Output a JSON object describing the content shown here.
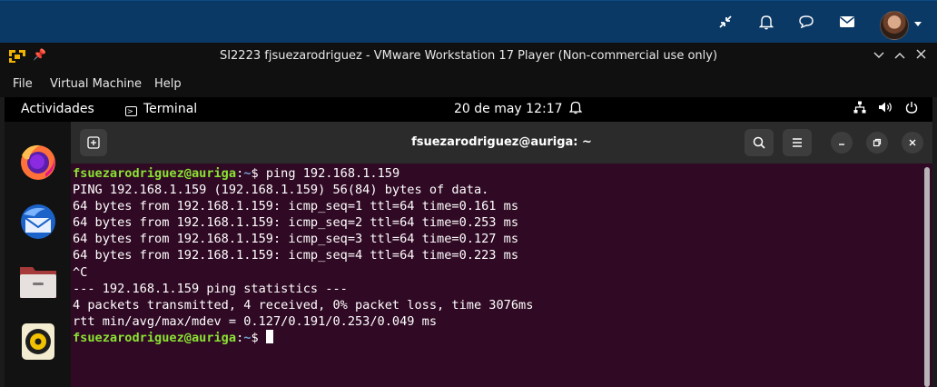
{
  "host_bar": {
    "icons": [
      "collapse-icon",
      "bell-icon",
      "chat-icon",
      "mail-icon",
      "avatar",
      "chevron-down-icon"
    ]
  },
  "vmware": {
    "title": "SI2223 fjsuezarodriguez - VMware Workstation 17 Player (Non-commercial use only)",
    "menu": [
      "File",
      "Virtual Machine",
      "Help"
    ],
    "window_controls": [
      "minimize",
      "restore",
      "close"
    ]
  },
  "gnome_panel": {
    "activities": "Actividades",
    "app": "Terminal",
    "clock": "20 de may  12:17"
  },
  "dock": {
    "apps": [
      "Firefox",
      "Thunderbird",
      "Files",
      "Rhythmbox"
    ]
  },
  "terminal": {
    "title": "fsuezarodriguez@auriga: ~",
    "prompt_user": "fsuezarodriguez@auriga",
    "prompt_path": "~",
    "command": "ping 192.168.1.159",
    "output_lines": [
      "PING 192.168.1.159 (192.168.1.159) 56(84) bytes of data.",
      "64 bytes from 192.168.1.159: icmp_seq=1 ttl=64 time=0.161 ms",
      "64 bytes from 192.168.1.159: icmp_seq=2 ttl=64 time=0.253 ms",
      "64 bytes from 192.168.1.159: icmp_seq=3 ttl=64 time=0.127 ms",
      "64 bytes from 192.168.1.159: icmp_seq=4 ttl=64 time=0.223 ms",
      "^C",
      "--- 192.168.1.159 ping statistics ---",
      "4 packets transmitted, 4 received, 0% packet loss, time 3076ms",
      "rtt min/avg/max/mdev = 0.127/0.191/0.253/0.049 ms"
    ]
  },
  "colors": {
    "host_bar": "#0a3966",
    "terminal_bg": "#300a24",
    "prompt_user": "#8ae234",
    "prompt_path": "#729fcf"
  }
}
